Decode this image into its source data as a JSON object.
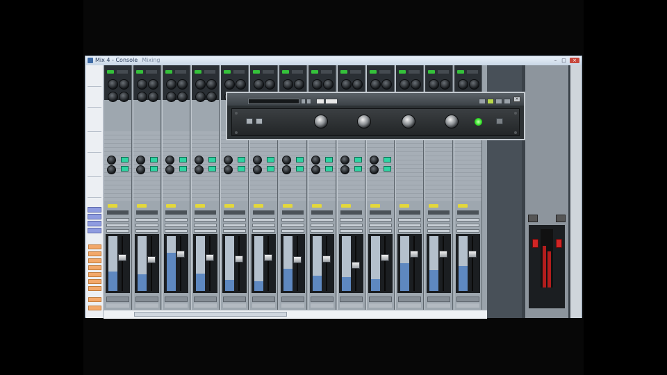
{
  "window": {
    "title": "Mix 4 - Console",
    "subtitle": "Mixing",
    "minimize_glyph": "–",
    "maximize_glyph": "□",
    "close_glyph": "×"
  },
  "plugin": {
    "title": "",
    "close_glyph": "×"
  },
  "colors": {
    "active_led": "#35c23b",
    "send_green": "#2fd3a2",
    "volume_yellow": "#e4d83a",
    "master_fader_red": "#d12525",
    "plugin_power_green": "#35e02a",
    "meter_blue": "#5e88c0"
  },
  "icons": {
    "app": "app-icon",
    "fader": "fader-cap-icon",
    "knob": "rotary-knob-icon",
    "plugin_power": "power-led-icon"
  },
  "mixer": {
    "channels": [
      {
        "meter": 0.35,
        "fader": 0.62
      },
      {
        "meter": 0.3,
        "fader": 0.58
      },
      {
        "meter": 0.7,
        "fader": 0.7
      },
      {
        "meter": 0.32,
        "fader": 0.62
      },
      {
        "meter": 0.2,
        "fader": 0.6
      },
      {
        "meter": 0.18,
        "fader": 0.62
      },
      {
        "meter": 0.4,
        "fader": 0.58
      },
      {
        "meter": 0.28,
        "fader": 0.6
      },
      {
        "meter": 0.25,
        "fader": 0.46
      },
      {
        "meter": 0.22,
        "fader": 0.62
      },
      {
        "meter": 0.5,
        "fader": 0.7
      },
      {
        "meter": 0.38,
        "fader": 0.7
      },
      {
        "meter": 0.45,
        "fader": 0.7
      }
    ]
  }
}
